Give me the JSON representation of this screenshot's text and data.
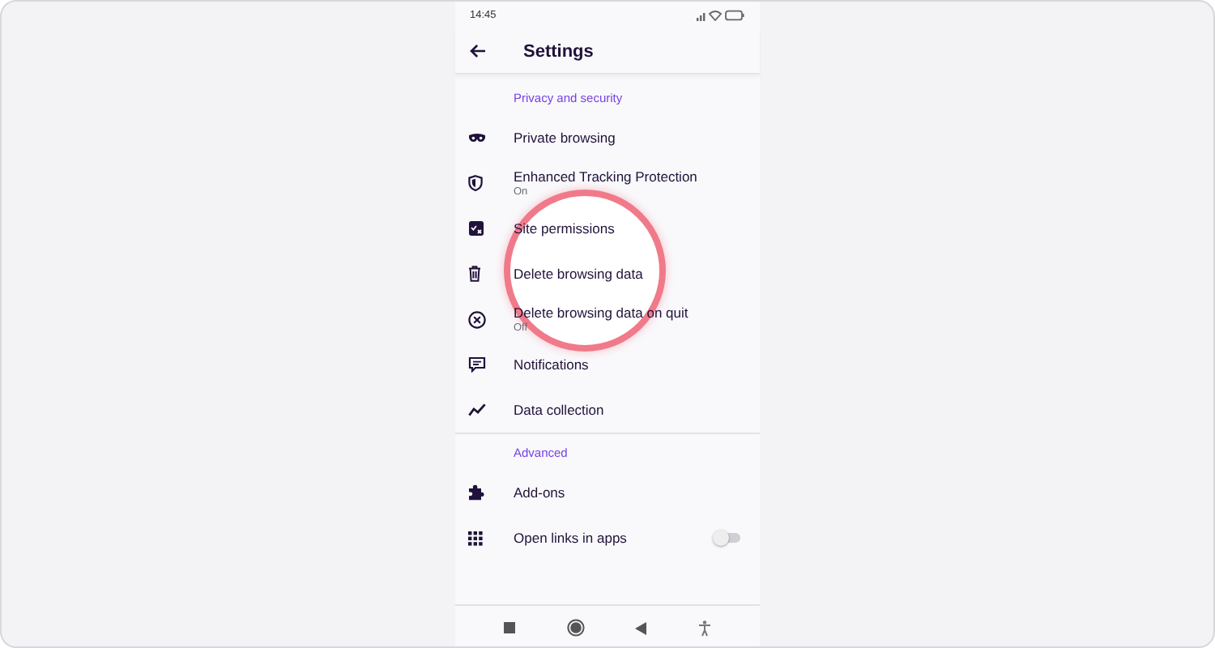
{
  "status_bar": {
    "time": "14:45"
  },
  "header": {
    "title": "Settings"
  },
  "sections": [
    {
      "title": "Privacy and security",
      "items": [
        {
          "label": "Private browsing",
          "kind": "link",
          "highlighted": false
        },
        {
          "label": "Enhanced Tracking Protection",
          "sublabel": "On",
          "kind": "link",
          "highlighted": false
        },
        {
          "label": "Site permissions",
          "kind": "link",
          "highlighted": false
        },
        {
          "label": "Delete browsing data",
          "kind": "link",
          "highlighted": true
        },
        {
          "label": "Delete browsing data on quit",
          "sublabel": "Off",
          "kind": "link",
          "highlighted": false
        },
        {
          "label": "Notifications",
          "kind": "link",
          "highlighted": false
        },
        {
          "label": "Data collection",
          "kind": "link",
          "highlighted": false
        }
      ]
    },
    {
      "title": "Advanced",
      "items": [
        {
          "label": "Add-ons",
          "kind": "link",
          "highlighted": false
        },
        {
          "label": "Open links in apps",
          "kind": "toggle",
          "on": false,
          "highlighted": false
        }
      ]
    }
  ]
}
